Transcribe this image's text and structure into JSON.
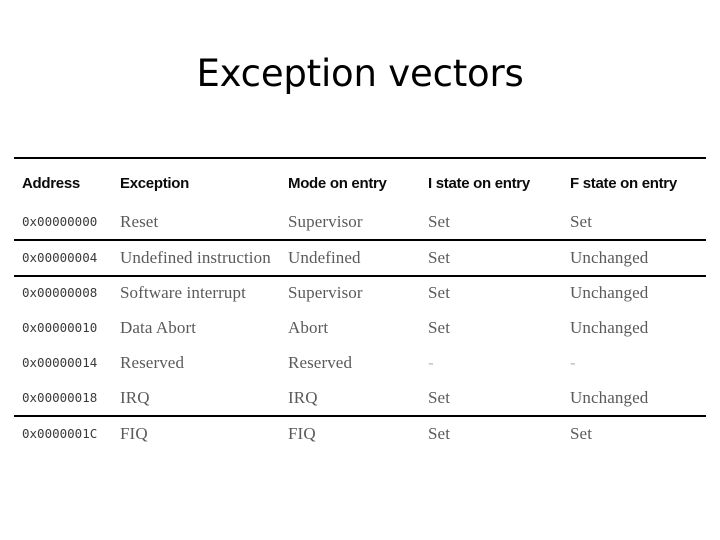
{
  "slide": {
    "title": "Exception vectors"
  },
  "table": {
    "headers": {
      "address": "Address",
      "exception": "Exception",
      "mode_on_entry": "Mode on entry",
      "i_state_on_entry": "I state on entry",
      "f_state_on_entry": "F state on entry"
    },
    "rows": [
      {
        "address": "0x00000000",
        "exception": "Reset",
        "mode": "Supervisor",
        "i_state": "Set",
        "f_state": "Set"
      },
      {
        "address": "0x00000004",
        "exception": "Undefined instruction",
        "mode": "Undefined",
        "i_state": "Set",
        "f_state": "Unchanged"
      },
      {
        "address": "0x00000008",
        "exception": "Software interrupt",
        "mode": "Supervisor",
        "i_state": "Set",
        "f_state": "Unchanged"
      },
      {
        "address": "0x00000010",
        "exception": "Data Abort",
        "mode": "Abort",
        "i_state": "Set",
        "f_state": "Unchanged"
      },
      {
        "address": "0x00000014",
        "exception": "Reserved",
        "mode": "Reserved",
        "i_state": "-",
        "f_state": "-"
      },
      {
        "address": "0x00000018",
        "exception": "IRQ",
        "mode": "IRQ",
        "i_state": "Set",
        "f_state": "Unchanged"
      },
      {
        "address": "0x0000001C",
        "exception": "FIQ",
        "mode": "FIQ",
        "i_state": "Set",
        "f_state": "Set"
      }
    ]
  },
  "colors": {
    "background": "#ffffff",
    "title_text": "#000000",
    "header_text": "#0b0b0b",
    "body_text": "#5a5a5a",
    "address_text": "#3a3a3a",
    "rule": "#000000",
    "dash": "#b9b9b9"
  }
}
